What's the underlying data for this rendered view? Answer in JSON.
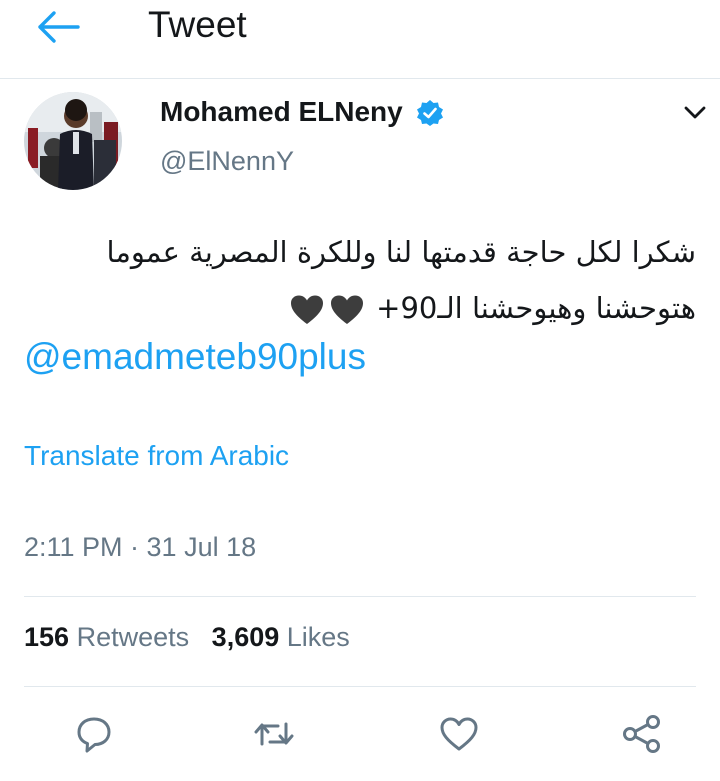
{
  "header": {
    "title": "Tweet",
    "back_icon": "arrow-left-icon"
  },
  "colors": {
    "accent": "#1da1f2",
    "secondary_text": "#657786",
    "divider": "#e1e8ed",
    "verified": "#1da1f2"
  },
  "author": {
    "name": "Mohamed ELNeny",
    "handle": "@ElNennY",
    "verified_icon": "verified-badge-icon",
    "menu_icon": "chevron-down-icon"
  },
  "tweet": {
    "line1": "شكرا لكل حاجة قدمتها لنا وللكرة المصرية عموما",
    "line2": "هتوحشنا وهيوحشنا الـ90+",
    "mention": "@emadmeteb90plus",
    "translate_label": "Translate from Arabic",
    "timestamp": "2:11 PM · 31 Jul 18"
  },
  "stats": {
    "retweets_count": "156",
    "retweets_label": "Retweets",
    "likes_count": "3,609",
    "likes_label": "Likes"
  },
  "actions": [
    "reply-icon",
    "retweet-icon",
    "like-icon",
    "share-icon"
  ]
}
